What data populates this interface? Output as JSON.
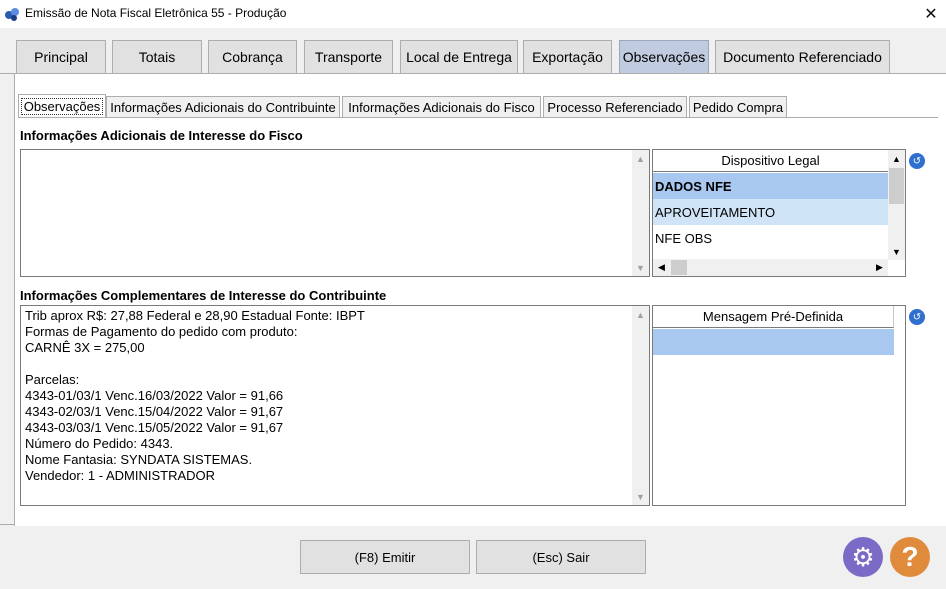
{
  "window": {
    "title": "Emissão de Nota Fiscal Eletrônica 55 - Produção",
    "close_glyph": "✕"
  },
  "main_tabs": [
    "Principal",
    "Totais",
    "Cobrança",
    "Transporte",
    "Local de Entrega",
    "Exportação",
    "Observações",
    "Documento Referenciado"
  ],
  "sub_tabs": [
    "Observações",
    "Informações Adicionais do Contribuinte",
    "Informações Adicionais do Fisco",
    "Processo Referenciado",
    "Pedido Compra"
  ],
  "fisco": {
    "label": "Informações Adicionais de Interesse do Fisco",
    "text": "",
    "grid_header": "Dispositivo Legal",
    "rows": [
      "DADOS NFE",
      "APROVEITAMENTO",
      "NFE OBS"
    ]
  },
  "contribuinte": {
    "label": "Informações Complementares de Interesse do Contribuinte",
    "text": "Trib aprox R$: 27,88 Federal e 28,90 Estadual Fonte: IBPT\nFormas de Pagamento do pedido com produto:\nCARNÊ 3X = 275,00\n\nParcelas:\n4343-01/03/1 Venc.16/03/2022 Valor = 91,66\n4343-02/03/1 Venc.15/04/2022 Valor = 91,67\n4343-03/03/1 Venc.15/05/2022 Valor = 91,67\nNúmero do Pedido: 4343.\nNome Fantasia: SYNDATA SISTEMAS.\nVendedor: 1 - ADMINISTRADOR",
    "grid_header": "Mensagem Pré-Definida"
  },
  "buttons": {
    "emitir": "(F8) Emitir",
    "sair": "(Esc) Sair",
    "settings_glyph": "⚙",
    "help_glyph": "?"
  },
  "colors": {
    "selected_row": "#a8c8f0",
    "alt_row": "#d0e4f7",
    "active_tab": "#c0cbe0",
    "settings": "#7b6bc7",
    "help": "#e08a3c"
  }
}
